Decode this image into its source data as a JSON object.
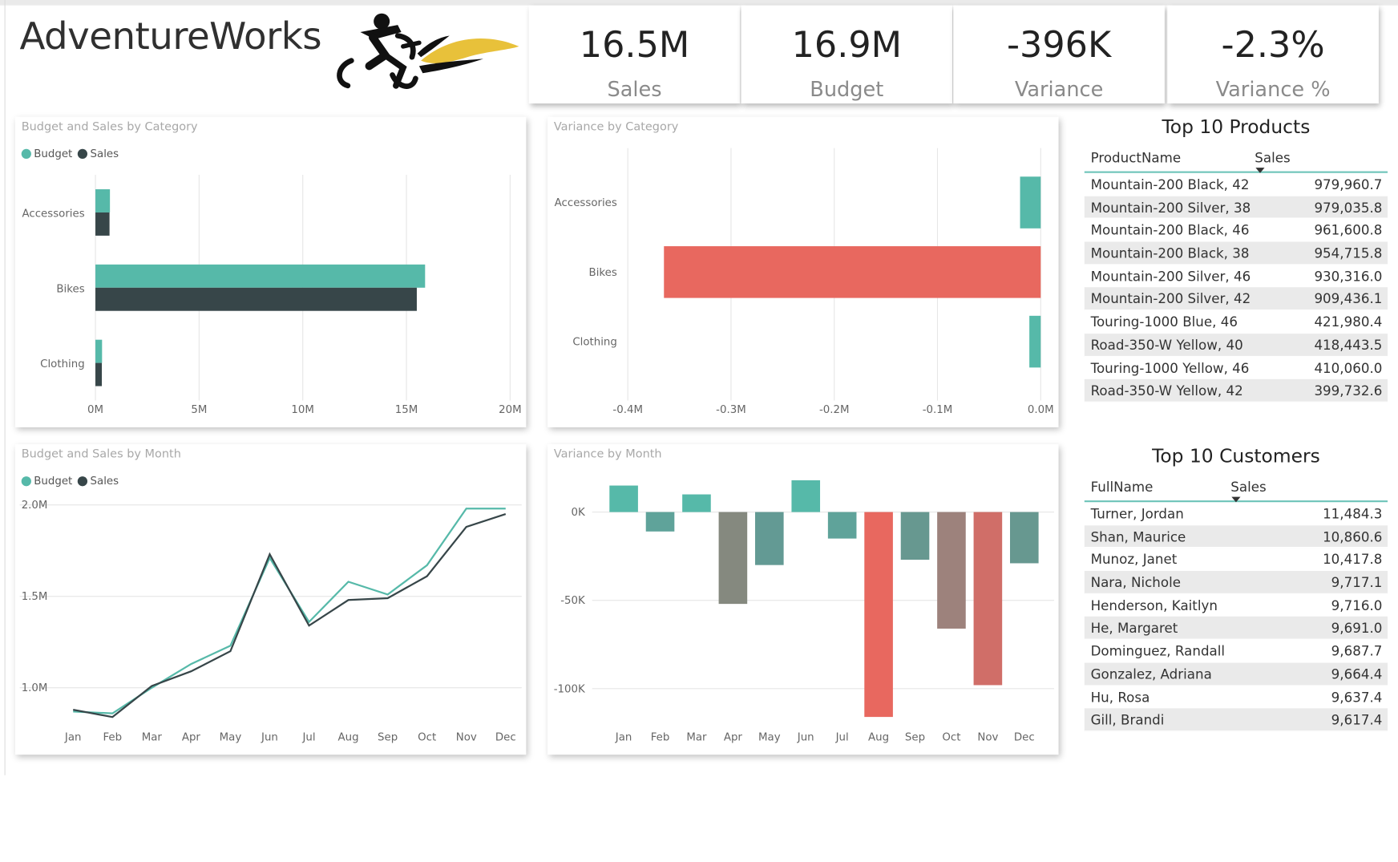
{
  "brand": {
    "name": "AdventureWorks"
  },
  "kpis": [
    {
      "value": "16.5M",
      "label": "Sales"
    },
    {
      "value": "16.9M",
      "label": "Budget"
    },
    {
      "value": "-396K",
      "label": "Variance"
    },
    {
      "value": "-2.3%",
      "label": "Variance %"
    }
  ],
  "colors": {
    "budget": "#56b9a9",
    "sales": "#374649",
    "negative": "#e8685f",
    "grid": "#e6e6e6",
    "axis_text": "#666666"
  },
  "panels": {
    "budget_sales_category": {
      "title": "Budget and Sales by Category",
      "legend": [
        "Budget",
        "Sales"
      ]
    },
    "variance_category": {
      "title": "Variance by Category"
    },
    "budget_sales_month": {
      "title": "Budget and Sales by Month",
      "legend": [
        "Budget",
        "Sales"
      ]
    },
    "variance_month": {
      "title": "Variance by Month"
    }
  },
  "chart_data": [
    {
      "type": "bar",
      "orientation": "horizontal",
      "title": "Budget and Sales by Category",
      "categories": [
        "Accessories",
        "Bikes",
        "Clothing"
      ],
      "series": [
        {
          "name": "Budget",
          "values": [
            700000,
            15900000,
            320000
          ]
        },
        {
          "name": "Sales",
          "values": [
            680000,
            15500000,
            310000
          ]
        }
      ],
      "xlim": [
        0,
        20000000
      ],
      "ticks": [
        "0M",
        "5M",
        "10M",
        "15M",
        "20M"
      ],
      "legend": "top-left",
      "grid": true
    },
    {
      "type": "bar",
      "orientation": "horizontal",
      "title": "Variance by Category",
      "categories": [
        "Accessories",
        "Bikes",
        "Clothing"
      ],
      "values": [
        -20000,
        -365000,
        -11000
      ],
      "xlim": [
        -0.4,
        0.0
      ],
      "ticks": [
        "-0.4M",
        "-0.3M",
        "-0.2M",
        "-0.1M",
        "0.0M"
      ],
      "grid": true
    },
    {
      "type": "line",
      "title": "Budget and Sales by Month",
      "categories": [
        "Jan",
        "Feb",
        "Mar",
        "Apr",
        "May",
        "Jun",
        "Jul",
        "Aug",
        "Sep",
        "Oct",
        "Nov",
        "Dec"
      ],
      "series": [
        {
          "name": "Budget",
          "values": [
            870000,
            860000,
            1000000,
            1130000,
            1230000,
            1710000,
            1360000,
            1580000,
            1510000,
            1670000,
            1980000,
            1980000
          ]
        },
        {
          "name": "Sales",
          "values": [
            880000,
            840000,
            1010000,
            1090000,
            1200000,
            1730000,
            1340000,
            1480000,
            1490000,
            1610000,
            1880000,
            1950000
          ]
        }
      ],
      "ylim": [
        0.8,
        2.0
      ],
      "yticks": [
        "1.0M",
        "1.5M",
        "2.0M"
      ],
      "legend": "top-left",
      "grid": true
    },
    {
      "type": "bar",
      "title": "Variance by Month",
      "categories": [
        "Jan",
        "Feb",
        "Mar",
        "Apr",
        "May",
        "Jun",
        "Jul",
        "Aug",
        "Sep",
        "Oct",
        "Nov",
        "Dec"
      ],
      "values": [
        15000,
        -11000,
        10000,
        -52000,
        -30000,
        18000,
        -15000,
        -116000,
        -27000,
        -66000,
        -98000,
        -29000
      ],
      "colors": [
        "#56b9a9",
        "#5fa39a",
        "#56b9a9",
        "#85897f",
        "#639a94",
        "#56b9a9",
        "#5fa39a",
        "#e8685f",
        "#679890",
        "#9d827c",
        "#d06e68",
        "#679890"
      ],
      "ylim": [
        -120000,
        20000
      ],
      "yticks": [
        "0K",
        "-50K",
        "-100K"
      ],
      "grid": true
    }
  ],
  "top_products": {
    "title": "Top 10 Products",
    "col_name": "ProductName",
    "col_value": "Sales",
    "rows": [
      {
        "name": "Mountain-200 Black, 42",
        "value": "979,960.7"
      },
      {
        "name": "Mountain-200 Silver, 38",
        "value": "979,035.8"
      },
      {
        "name": "Mountain-200 Black, 46",
        "value": "961,600.8"
      },
      {
        "name": "Mountain-200 Black, 38",
        "value": "954,715.8"
      },
      {
        "name": "Mountain-200 Silver, 46",
        "value": "930,316.0"
      },
      {
        "name": "Mountain-200 Silver, 42",
        "value": "909,436.1"
      },
      {
        "name": "Touring-1000 Blue, 46",
        "value": "421,980.4"
      },
      {
        "name": "Road-350-W Yellow, 40",
        "value": "418,443.5"
      },
      {
        "name": "Touring-1000 Yellow, 46",
        "value": "410,060.0"
      },
      {
        "name": "Road-350-W Yellow, 42",
        "value": "399,732.6"
      }
    ]
  },
  "top_customers": {
    "title": "Top 10 Customers",
    "col_name": "FullName",
    "col_value": "Sales",
    "rows": [
      {
        "name": "Turner, Jordan",
        "value": "11,484.3"
      },
      {
        "name": "Shan, Maurice",
        "value": "10,860.6"
      },
      {
        "name": "Munoz, Janet",
        "value": "10,417.8"
      },
      {
        "name": "Nara, Nichole",
        "value": "9,717.1"
      },
      {
        "name": "Henderson, Kaitlyn",
        "value": "9,716.0"
      },
      {
        "name": "He, Margaret",
        "value": "9,691.0"
      },
      {
        "name": "Dominguez, Randall",
        "value": "9,687.7"
      },
      {
        "name": "Gonzalez, Adriana",
        "value": "9,664.4"
      },
      {
        "name": "Hu, Rosa",
        "value": "9,637.4"
      },
      {
        "name": "Gill, Brandi",
        "value": "9,617.4"
      }
    ]
  }
}
